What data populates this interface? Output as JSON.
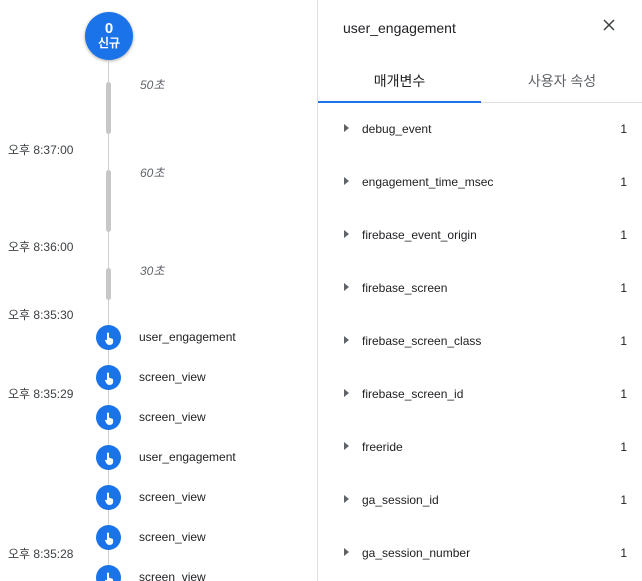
{
  "timeline": {
    "new_badge": {
      "count": "0",
      "label": "신규"
    },
    "gap_labels": [
      "50초",
      "60초",
      "30초"
    ],
    "time_labels": [
      "오후 8:37:00",
      "오후 8:36:00",
      "오후 8:35:30",
      "오후 8:35:29",
      "오후 8:35:28"
    ],
    "events": [
      {
        "name": "user_engagement",
        "icon": "touch-icon"
      },
      {
        "name": "screen_view",
        "icon": "touch-icon"
      },
      {
        "name": "screen_view",
        "icon": "touch-icon"
      },
      {
        "name": "user_engagement",
        "icon": "touch-icon"
      },
      {
        "name": "screen_view",
        "icon": "touch-icon"
      },
      {
        "name": "screen_view",
        "icon": "touch-icon"
      },
      {
        "name": "screen_view",
        "icon": "touch-icon"
      }
    ]
  },
  "panel": {
    "title": "user_engagement",
    "close_icon": "close-icon",
    "tabs": [
      {
        "label": "매개변수",
        "active": true
      },
      {
        "label": "사용자 속성",
        "active": false
      }
    ],
    "params": [
      {
        "name": "debug_event",
        "count": "1"
      },
      {
        "name": "engagement_time_msec",
        "count": "1"
      },
      {
        "name": "firebase_event_origin",
        "count": "1"
      },
      {
        "name": "firebase_screen",
        "count": "1"
      },
      {
        "name": "firebase_screen_class",
        "count": "1"
      },
      {
        "name": "firebase_screen_id",
        "count": "1"
      },
      {
        "name": "freeride",
        "count": "1"
      },
      {
        "name": "ga_session_id",
        "count": "1"
      },
      {
        "name": "ga_session_number",
        "count": "1"
      }
    ]
  },
  "colors": {
    "accent": "#1a73e8",
    "gap_bar": "#c7c7c7",
    "divider": "#e0e0e0"
  }
}
